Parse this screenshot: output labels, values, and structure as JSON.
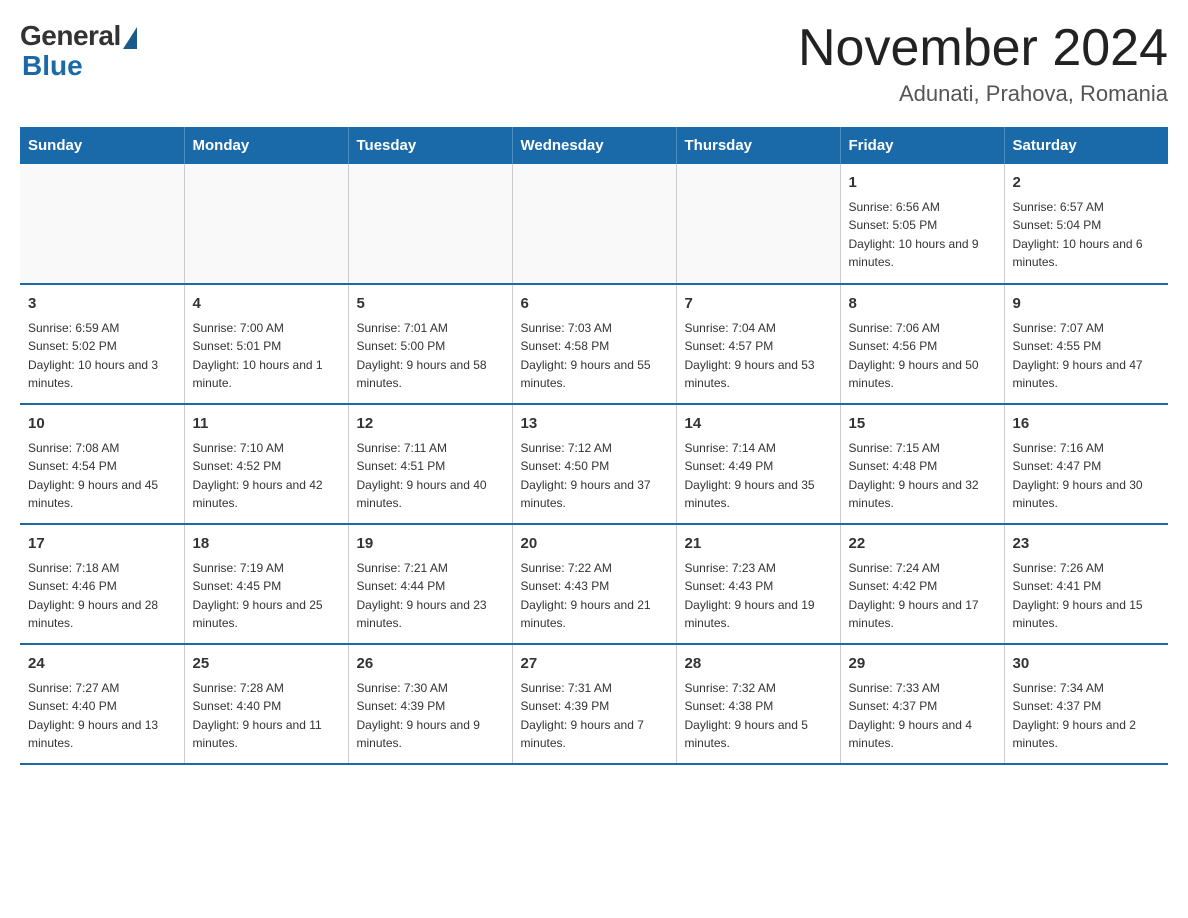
{
  "logo": {
    "general_text": "General",
    "blue_text": "Blue"
  },
  "header": {
    "title": "November 2024",
    "subtitle": "Adunati, Prahova, Romania"
  },
  "days_of_week": [
    "Sunday",
    "Monday",
    "Tuesday",
    "Wednesday",
    "Thursday",
    "Friday",
    "Saturday"
  ],
  "weeks": [
    [
      {
        "day": "",
        "info": ""
      },
      {
        "day": "",
        "info": ""
      },
      {
        "day": "",
        "info": ""
      },
      {
        "day": "",
        "info": ""
      },
      {
        "day": "",
        "info": ""
      },
      {
        "day": "1",
        "info": "Sunrise: 6:56 AM\nSunset: 5:05 PM\nDaylight: 10 hours and 9 minutes."
      },
      {
        "day": "2",
        "info": "Sunrise: 6:57 AM\nSunset: 5:04 PM\nDaylight: 10 hours and 6 minutes."
      }
    ],
    [
      {
        "day": "3",
        "info": "Sunrise: 6:59 AM\nSunset: 5:02 PM\nDaylight: 10 hours and 3 minutes."
      },
      {
        "day": "4",
        "info": "Sunrise: 7:00 AM\nSunset: 5:01 PM\nDaylight: 10 hours and 1 minute."
      },
      {
        "day": "5",
        "info": "Sunrise: 7:01 AM\nSunset: 5:00 PM\nDaylight: 9 hours and 58 minutes."
      },
      {
        "day": "6",
        "info": "Sunrise: 7:03 AM\nSunset: 4:58 PM\nDaylight: 9 hours and 55 minutes."
      },
      {
        "day": "7",
        "info": "Sunrise: 7:04 AM\nSunset: 4:57 PM\nDaylight: 9 hours and 53 minutes."
      },
      {
        "day": "8",
        "info": "Sunrise: 7:06 AM\nSunset: 4:56 PM\nDaylight: 9 hours and 50 minutes."
      },
      {
        "day": "9",
        "info": "Sunrise: 7:07 AM\nSunset: 4:55 PM\nDaylight: 9 hours and 47 minutes."
      }
    ],
    [
      {
        "day": "10",
        "info": "Sunrise: 7:08 AM\nSunset: 4:54 PM\nDaylight: 9 hours and 45 minutes."
      },
      {
        "day": "11",
        "info": "Sunrise: 7:10 AM\nSunset: 4:52 PM\nDaylight: 9 hours and 42 minutes."
      },
      {
        "day": "12",
        "info": "Sunrise: 7:11 AM\nSunset: 4:51 PM\nDaylight: 9 hours and 40 minutes."
      },
      {
        "day": "13",
        "info": "Sunrise: 7:12 AM\nSunset: 4:50 PM\nDaylight: 9 hours and 37 minutes."
      },
      {
        "day": "14",
        "info": "Sunrise: 7:14 AM\nSunset: 4:49 PM\nDaylight: 9 hours and 35 minutes."
      },
      {
        "day": "15",
        "info": "Sunrise: 7:15 AM\nSunset: 4:48 PM\nDaylight: 9 hours and 32 minutes."
      },
      {
        "day": "16",
        "info": "Sunrise: 7:16 AM\nSunset: 4:47 PM\nDaylight: 9 hours and 30 minutes."
      }
    ],
    [
      {
        "day": "17",
        "info": "Sunrise: 7:18 AM\nSunset: 4:46 PM\nDaylight: 9 hours and 28 minutes."
      },
      {
        "day": "18",
        "info": "Sunrise: 7:19 AM\nSunset: 4:45 PM\nDaylight: 9 hours and 25 minutes."
      },
      {
        "day": "19",
        "info": "Sunrise: 7:21 AM\nSunset: 4:44 PM\nDaylight: 9 hours and 23 minutes."
      },
      {
        "day": "20",
        "info": "Sunrise: 7:22 AM\nSunset: 4:43 PM\nDaylight: 9 hours and 21 minutes."
      },
      {
        "day": "21",
        "info": "Sunrise: 7:23 AM\nSunset: 4:43 PM\nDaylight: 9 hours and 19 minutes."
      },
      {
        "day": "22",
        "info": "Sunrise: 7:24 AM\nSunset: 4:42 PM\nDaylight: 9 hours and 17 minutes."
      },
      {
        "day": "23",
        "info": "Sunrise: 7:26 AM\nSunset: 4:41 PM\nDaylight: 9 hours and 15 minutes."
      }
    ],
    [
      {
        "day": "24",
        "info": "Sunrise: 7:27 AM\nSunset: 4:40 PM\nDaylight: 9 hours and 13 minutes."
      },
      {
        "day": "25",
        "info": "Sunrise: 7:28 AM\nSunset: 4:40 PM\nDaylight: 9 hours and 11 minutes."
      },
      {
        "day": "26",
        "info": "Sunrise: 7:30 AM\nSunset: 4:39 PM\nDaylight: 9 hours and 9 minutes."
      },
      {
        "day": "27",
        "info": "Sunrise: 7:31 AM\nSunset: 4:39 PM\nDaylight: 9 hours and 7 minutes."
      },
      {
        "day": "28",
        "info": "Sunrise: 7:32 AM\nSunset: 4:38 PM\nDaylight: 9 hours and 5 minutes."
      },
      {
        "day": "29",
        "info": "Sunrise: 7:33 AM\nSunset: 4:37 PM\nDaylight: 9 hours and 4 minutes."
      },
      {
        "day": "30",
        "info": "Sunrise: 7:34 AM\nSunset: 4:37 PM\nDaylight: 9 hours and 2 minutes."
      }
    ]
  ]
}
